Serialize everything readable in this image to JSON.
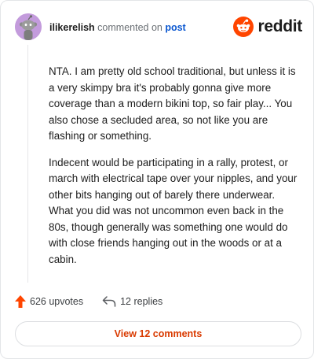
{
  "header": {
    "username": "ilikerelish",
    "action_text": " commented on ",
    "post_link": "post",
    "brand_word": "reddit"
  },
  "comment": {
    "paragraphs": [
      "NTA. I am pretty old school traditional, but unless it is a very skimpy bra it's probably gonna give more coverage than a modern bikini top, so fair play... You also chose a secluded area, so not like you are flashing or something.",
      "Indecent would be participating in a rally, protest, or march with electrical tape over your nipples, and your other bits hanging out of barely there underwear. What you did was not uncommon even back in the 80s, though generally was something one would do with close friends hanging out in the woods or at a cabin."
    ]
  },
  "actions": {
    "upvotes": "626 upvotes",
    "replies": "12 replies"
  },
  "footer": {
    "view_comments": "View 12 comments"
  },
  "colors": {
    "brand": "#ff4500",
    "link": "#0a57d0",
    "avatar_bg": "#c39bdc",
    "view_button_text": "#d93a00"
  },
  "icons": {
    "avatar": "snoo-avatar-icon",
    "brand": "reddit-logo-icon",
    "upvote": "upvote-arrow-icon",
    "reply": "reply-arrow-icon"
  }
}
